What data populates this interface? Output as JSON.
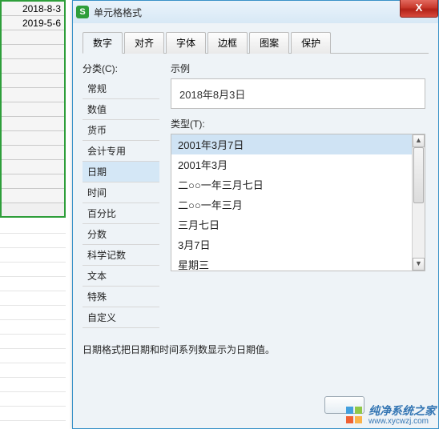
{
  "spreadsheet": {
    "cells": [
      "2018-8-3",
      "2019-5-6"
    ]
  },
  "dialog": {
    "title": "单元格格式",
    "close_icon": "X",
    "tabs": [
      {
        "label": "数字",
        "active": true
      },
      {
        "label": "对齐",
        "active": false
      },
      {
        "label": "字体",
        "active": false
      },
      {
        "label": "边框",
        "active": false
      },
      {
        "label": "图案",
        "active": false
      },
      {
        "label": "保护",
        "active": false
      }
    ],
    "category": {
      "label": "分类(C):",
      "items": [
        "常规",
        "数值",
        "货币",
        "会计专用",
        "日期",
        "时间",
        "百分比",
        "分数",
        "科学记数",
        "文本",
        "特殊",
        "自定义"
      ],
      "selected_index": 4
    },
    "sample": {
      "label": "示例",
      "value": "2018年8月3日"
    },
    "type": {
      "label": "类型(T):",
      "items": [
        "2001年3月7日",
        "2001年3月",
        "二○○一年三月七日",
        "二○○一年三月",
        "三月七日",
        "3月7日",
        "星期三"
      ],
      "selected_index": 0
    },
    "description": "日期格式把日期和时间系列数显示为日期值。"
  },
  "watermark": {
    "name": "纯净系统之家",
    "url": "www.xycwzj.com",
    "colors": [
      "#3a9bdc",
      "#8cc63f",
      "#f15a29",
      "#fbb040"
    ]
  }
}
